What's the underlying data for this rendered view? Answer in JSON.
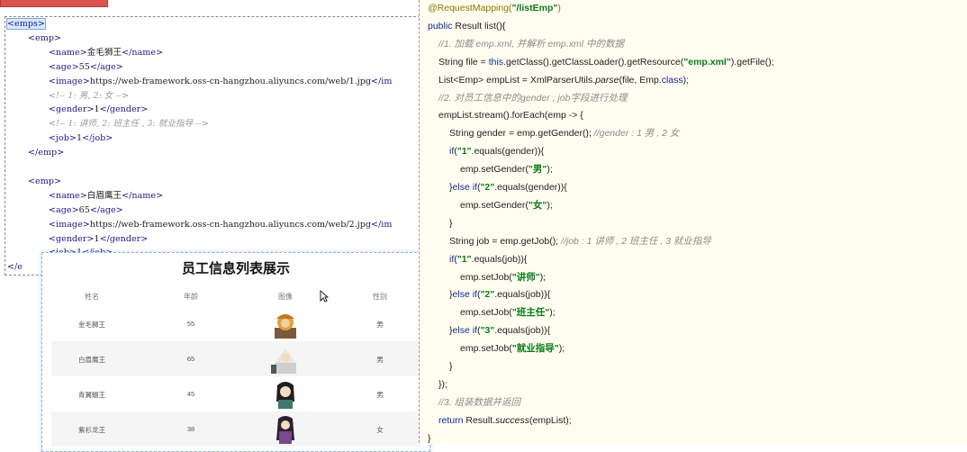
{
  "xml": {
    "lines": [
      {
        "indent": 0,
        "parts": [
          {
            "t": "<emps>",
            "c": "tag root-sel"
          }
        ]
      },
      {
        "indent": 1,
        "parts": [
          {
            "t": "<emp>",
            "c": "tag"
          }
        ]
      },
      {
        "indent": 2,
        "parts": [
          {
            "t": "<name>",
            "c": "tag"
          },
          {
            "t": "金毛狮王",
            "c": ""
          },
          {
            "t": "</name>",
            "c": "tag"
          }
        ]
      },
      {
        "indent": 2,
        "parts": [
          {
            "t": "<age>",
            "c": "tag"
          },
          {
            "t": "55",
            "c": ""
          },
          {
            "t": "</age>",
            "c": "tag"
          }
        ]
      },
      {
        "indent": 2,
        "parts": [
          {
            "t": "<image>",
            "c": "tag"
          },
          {
            "t": "https://web-framework.oss-cn-hangzhou.aliyuncs.com/web/1.jpg",
            "c": ""
          },
          {
            "t": "</im",
            "c": "tag"
          }
        ]
      },
      {
        "indent": 2,
        "parts": [
          {
            "t": "<!-- 1: 男, 2: 女 -->",
            "c": "cmt"
          }
        ]
      },
      {
        "indent": 2,
        "parts": [
          {
            "t": "<gender>",
            "c": "tag"
          },
          {
            "t": "1",
            "c": ""
          },
          {
            "t": "</gender>",
            "c": "tag"
          }
        ]
      },
      {
        "indent": 2,
        "parts": [
          {
            "t": "<!-- 1: 讲师, 2: 班主任 , 3: 就业指导 -->",
            "c": "cmt"
          }
        ]
      },
      {
        "indent": 2,
        "parts": [
          {
            "t": "<job>",
            "c": "tag"
          },
          {
            "t": "1",
            "c": ""
          },
          {
            "t": "</job>",
            "c": "tag"
          }
        ]
      },
      {
        "indent": 1,
        "parts": [
          {
            "t": "</emp>",
            "c": "tag"
          }
        ]
      },
      {
        "indent": 0,
        "parts": []
      },
      {
        "indent": 1,
        "parts": [
          {
            "t": "<emp>",
            "c": "tag"
          }
        ]
      },
      {
        "indent": 2,
        "parts": [
          {
            "t": "<name>",
            "c": "tag"
          },
          {
            "t": "白眉鹰王",
            "c": ""
          },
          {
            "t": "</name>",
            "c": "tag"
          }
        ]
      },
      {
        "indent": 2,
        "parts": [
          {
            "t": "<age>",
            "c": "tag"
          },
          {
            "t": "65",
            "c": ""
          },
          {
            "t": "</age>",
            "c": "tag"
          }
        ]
      },
      {
        "indent": 2,
        "parts": [
          {
            "t": "<image>",
            "c": "tag"
          },
          {
            "t": "https://web-framework.oss-cn-hangzhou.aliyuncs.com/web/2.jpg",
            "c": ""
          },
          {
            "t": "</im",
            "c": "tag"
          }
        ]
      },
      {
        "indent": 2,
        "parts": [
          {
            "t": "<gender>",
            "c": "tag"
          },
          {
            "t": "1",
            "c": ""
          },
          {
            "t": "</gender>",
            "c": "tag"
          }
        ]
      },
      {
        "indent": 2,
        "parts": [
          {
            "t": "<job>",
            "c": "tag"
          },
          {
            "t": "1",
            "c": ""
          },
          {
            "t": "</job>",
            "c": "tag"
          }
        ]
      },
      {
        "indent": 0,
        "parts": [
          {
            "t": "</e",
            "c": "tag"
          }
        ]
      }
    ]
  },
  "table": {
    "title": "员工信息列表展示",
    "headers": [
      "姓名",
      "年龄",
      "图像",
      "性别"
    ],
    "rows": [
      {
        "name": "金毛狮王",
        "age": "55",
        "gender": "男"
      },
      {
        "name": "白眉鹰王",
        "age": "65",
        "gender": "男"
      },
      {
        "name": "青翼蝠王",
        "age": "45",
        "gender": "男"
      },
      {
        "name": "紫衫龙王",
        "age": "38",
        "gender": "女"
      }
    ]
  },
  "code": {
    "lines": [
      {
        "indent": 0,
        "parts": [
          {
            "t": "@RequestMapping(",
            "c": "ann"
          },
          {
            "t": "\"/listEmp\"",
            "c": "str"
          },
          {
            "t": ")",
            "c": "ann"
          }
        ]
      },
      {
        "indent": 0,
        "parts": [
          {
            "t": "public ",
            "c": "kw"
          },
          {
            "t": "Result list(){",
            "c": ""
          }
        ]
      },
      {
        "indent": 1,
        "parts": [
          {
            "t": "//1. 加载 emp.xml, 并解析 emp.xml 中的数据",
            "c": "jc"
          }
        ]
      },
      {
        "indent": 1,
        "parts": [
          {
            "t": "String file = ",
            "c": ""
          },
          {
            "t": "this",
            "c": "kw"
          },
          {
            "t": ".getClass().getClassLoader().getResource(",
            "c": ""
          },
          {
            "t": "\"emp.xml\"",
            "c": "str"
          },
          {
            "t": ").getFile();",
            "c": ""
          }
        ]
      },
      {
        "indent": 1,
        "parts": [
          {
            "t": "List<Emp> empList = XmlParserUtils.",
            "c": ""
          },
          {
            "t": "parse",
            "c": "it"
          },
          {
            "t": "(file, Emp.",
            "c": ""
          },
          {
            "t": "class",
            "c": "kw"
          },
          {
            "t": ");",
            "c": ""
          }
        ]
      },
      {
        "indent": 1,
        "parts": [
          {
            "t": "//2. 对员工信息中的gender , job字段进行处理",
            "c": "jc"
          }
        ]
      },
      {
        "indent": 1,
        "parts": [
          {
            "t": "empList.stream().forEach(emp -> {",
            "c": ""
          }
        ]
      },
      {
        "indent": 2,
        "parts": [
          {
            "t": "String gender = emp.getGender(); ",
            "c": ""
          },
          {
            "t": "//gender : 1 男 , 2 女",
            "c": "jc"
          }
        ]
      },
      {
        "indent": 2,
        "parts": [
          {
            "t": "if",
            "c": "kw"
          },
          {
            "t": "(",
            "c": ""
          },
          {
            "t": "\"1\"",
            "c": "str"
          },
          {
            "t": ".equals(gender)){",
            "c": ""
          }
        ]
      },
      {
        "indent": 3,
        "parts": [
          {
            "t": "emp.setGender(",
            "c": ""
          },
          {
            "t": "\"男\"",
            "c": "str"
          },
          {
            "t": ");",
            "c": ""
          }
        ]
      },
      {
        "indent": 2,
        "parts": [
          {
            "t": "}",
            "c": ""
          },
          {
            "t": "else if",
            "c": "kw"
          },
          {
            "t": "(",
            "c": ""
          },
          {
            "t": "\"2\"",
            "c": "str"
          },
          {
            "t": ".equals(gender)){",
            "c": ""
          }
        ]
      },
      {
        "indent": 3,
        "parts": [
          {
            "t": "emp.setGender(",
            "c": ""
          },
          {
            "t": "\"女\"",
            "c": "str"
          },
          {
            "t": ");",
            "c": ""
          }
        ]
      },
      {
        "indent": 2,
        "parts": [
          {
            "t": "}",
            "c": ""
          }
        ]
      },
      {
        "indent": 2,
        "parts": [
          {
            "t": "String job = emp.getJob(); ",
            "c": ""
          },
          {
            "t": "//job : 1 讲师 , 2 班主任 , 3 就业指导",
            "c": "jc"
          }
        ]
      },
      {
        "indent": 2,
        "parts": [
          {
            "t": "if",
            "c": "kw"
          },
          {
            "t": "(",
            "c": ""
          },
          {
            "t": "\"1\"",
            "c": "str"
          },
          {
            "t": ".equals(job)){",
            "c": ""
          }
        ]
      },
      {
        "indent": 3,
        "parts": [
          {
            "t": "emp.setJob(",
            "c": ""
          },
          {
            "t": "\"讲师\"",
            "c": "str"
          },
          {
            "t": ");",
            "c": ""
          }
        ]
      },
      {
        "indent": 2,
        "parts": [
          {
            "t": "}",
            "c": ""
          },
          {
            "t": "else if",
            "c": "kw"
          },
          {
            "t": "(",
            "c": ""
          },
          {
            "t": "\"2\"",
            "c": "str"
          },
          {
            "t": ".equals(job)){",
            "c": ""
          }
        ]
      },
      {
        "indent": 3,
        "parts": [
          {
            "t": "emp.setJob(",
            "c": ""
          },
          {
            "t": "\"班主任\"",
            "c": "str"
          },
          {
            "t": ");",
            "c": ""
          }
        ]
      },
      {
        "indent": 2,
        "parts": [
          {
            "t": "}",
            "c": ""
          },
          {
            "t": "else if",
            "c": "kw"
          },
          {
            "t": "(",
            "c": ""
          },
          {
            "t": "\"3\"",
            "c": "str"
          },
          {
            "t": ".equals(job)){",
            "c": ""
          }
        ]
      },
      {
        "indent": 3,
        "parts": [
          {
            "t": "emp.setJob(",
            "c": ""
          },
          {
            "t": "\"就业指导\"",
            "c": "str"
          },
          {
            "t": ");",
            "c": ""
          }
        ]
      },
      {
        "indent": 2,
        "parts": [
          {
            "t": "}",
            "c": ""
          }
        ]
      },
      {
        "indent": 1,
        "parts": [
          {
            "t": "});",
            "c": ""
          }
        ]
      },
      {
        "indent": 1,
        "parts": [
          {
            "t": "//3. 组装数据并返回",
            "c": "jc"
          }
        ]
      },
      {
        "indent": 1,
        "parts": [
          {
            "t": "return ",
            "c": "kw"
          },
          {
            "t": "Result.",
            "c": ""
          },
          {
            "t": "success",
            "c": "it"
          },
          {
            "t": "(empList);",
            "c": ""
          }
        ]
      },
      {
        "indent": 0,
        "parts": [
          {
            "t": "}",
            "c": ""
          }
        ]
      }
    ]
  },
  "colors": {
    "accent_red": "#d9534f",
    "code_bg": "#fffdf0",
    "keyword": "#0d2a9b",
    "string": "#0a7a1d"
  }
}
